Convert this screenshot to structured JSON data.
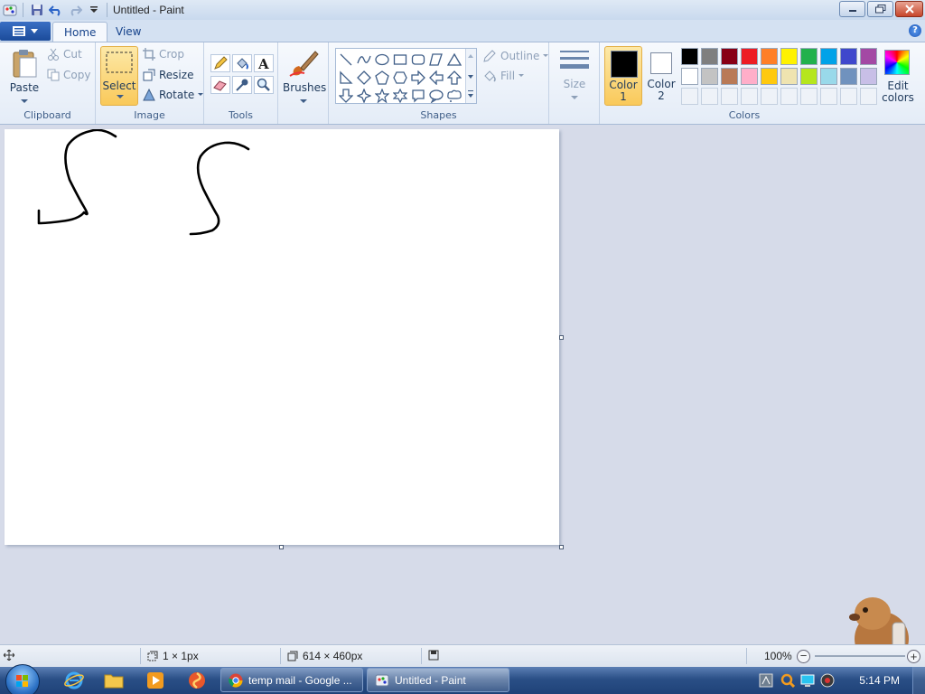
{
  "window": {
    "title": "Untitled - Paint"
  },
  "tabs": {
    "home": "Home",
    "view": "View"
  },
  "clipboard": {
    "paste": "Paste",
    "cut": "Cut",
    "copy": "Copy",
    "label": "Clipboard"
  },
  "image": {
    "select": "Select",
    "crop": "Crop",
    "resize": "Resize",
    "rotate": "Rotate",
    "label": "Image"
  },
  "tools": {
    "label": "Tools"
  },
  "brushes": {
    "label": "Brushes"
  },
  "shapes": {
    "outline": "Outline",
    "fill": "Fill",
    "label": "Shapes"
  },
  "size": {
    "label": "Size"
  },
  "colors": {
    "color1_label": "Color",
    "color1_num": "1",
    "color2_label": "Color",
    "color2_num": "2",
    "edit_line1": "Edit",
    "edit_line2": "colors",
    "label": "Colors",
    "color1_value": "#000000",
    "color2_value": "#ffffff",
    "palette_row1": [
      "#000000",
      "#7f7f7f",
      "#880015",
      "#ed1c24",
      "#ff7f27",
      "#fff200",
      "#22b14c",
      "#00a2e8",
      "#3f48cc",
      "#a349a4"
    ],
    "palette_row2": [
      "#ffffff",
      "#c3c3c3",
      "#b97a57",
      "#ffaec9",
      "#ffc90e",
      "#efe4b0",
      "#b5e61d",
      "#99d9ea",
      "#7092be",
      "#c8bfe7"
    ]
  },
  "status": {
    "cursor_size": "1 × 1px",
    "canvas_size": "614 × 460px",
    "zoom": "100%"
  },
  "taskbar": {
    "tasks": [
      {
        "label": "temp mail - Google ...",
        "icon": "chrome-icon"
      },
      {
        "label": "Untitled - Paint",
        "icon": "paint-icon"
      }
    ],
    "clock": "5:14 PM"
  }
}
